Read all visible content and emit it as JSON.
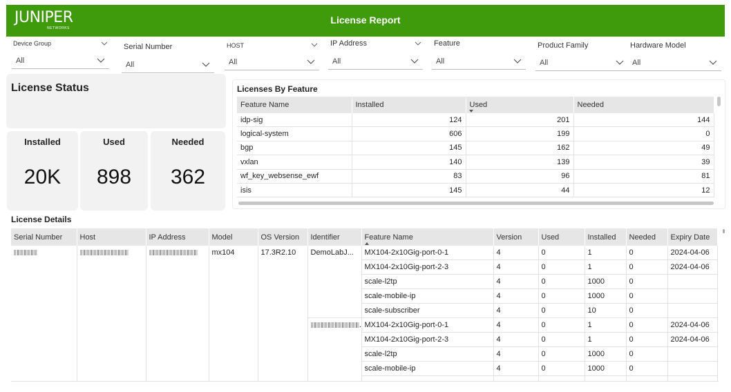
{
  "header": {
    "logo_text": "JUNIPER",
    "logo_sub": "NETWORKS",
    "title": "License Report",
    "background": "#3f9b0b"
  },
  "filters": [
    {
      "label": "Device Group",
      "value": "All"
    },
    {
      "label": "Serial Number",
      "value": "All"
    },
    {
      "label": "HOST",
      "value": "All"
    },
    {
      "label": "IP Address",
      "value": "All"
    },
    {
      "label": "Feature",
      "value": "All"
    },
    {
      "label": "Product Family",
      "value": "All"
    },
    {
      "label": "Hardware Model",
      "value": "All"
    }
  ],
  "license_status": {
    "title": "License Status",
    "installed_label": "Installed",
    "installed_value": "20K",
    "used_label": "Used",
    "used_value": "898",
    "needed_label": "Needed",
    "needed_value": "362"
  },
  "licenses_by_feature": {
    "title": "Licenses By Feature",
    "columns": [
      "Feature Name",
      "Installed",
      "Used",
      "Needed"
    ],
    "sorted_column": "Used",
    "rows": [
      [
        "idp-sig",
        "124",
        "201",
        "144"
      ],
      [
        "logical-system",
        "606",
        "199",
        "0"
      ],
      [
        "bgp",
        "145",
        "162",
        "49"
      ],
      [
        "vxlan",
        "140",
        "139",
        "39"
      ],
      [
        "wf_key_websense_ewf",
        "83",
        "96",
        "81"
      ],
      [
        "isis",
        "145",
        "44",
        "12"
      ]
    ]
  },
  "license_details": {
    "title": "License Details",
    "columns": [
      "Serial Number",
      "Host",
      "IP Address",
      "Model",
      "OS Version",
      "Identifier",
      "Feature Name",
      "Version",
      "Used",
      "Installed",
      "Needed",
      "Expiry Date"
    ],
    "sorted_column": "Feature Name",
    "device": {
      "model": "mx104",
      "os_version": "17.3R2.10",
      "identifier": "DemoLabJ..."
    },
    "rows": [
      {
        "feature": "MX104-2x10Gig-port-0-1",
        "version": "4",
        "used": "0",
        "installed": "1",
        "needed": "0",
        "expiry": "2024-04-06"
      },
      {
        "feature": "MX104-2x10Gig-port-2-3",
        "version": "4",
        "used": "0",
        "installed": "1",
        "needed": "0",
        "expiry": "2024-04-06"
      },
      {
        "feature": "scale-l2tp",
        "version": "4",
        "used": "0",
        "installed": "1000",
        "needed": "0",
        "expiry": ""
      },
      {
        "feature": "scale-mobile-ip",
        "version": "4",
        "used": "0",
        "installed": "1000",
        "needed": "0",
        "expiry": ""
      },
      {
        "feature": "scale-subscriber",
        "version": "4",
        "used": "0",
        "installed": "10",
        "needed": "0",
        "expiry": ""
      },
      {
        "feature": "MX104-2x10Gig-port-0-1",
        "version": "4",
        "used": "0",
        "installed": "1",
        "needed": "0",
        "expiry": "2024-04-06"
      },
      {
        "feature": "MX104-2x10Gig-port-2-3",
        "version": "4",
        "used": "0",
        "installed": "1",
        "needed": "0",
        "expiry": "2024-04-06"
      },
      {
        "feature": "scale-l2tp",
        "version": "4",
        "used": "0",
        "installed": "1000",
        "needed": "0",
        "expiry": ""
      },
      {
        "feature": "scale-mobile-ip",
        "version": "4",
        "used": "0",
        "installed": "1000",
        "needed": "0",
        "expiry": ""
      },
      {
        "feature": "",
        "version": "",
        "used": "",
        "installed": "",
        "needed": "",
        "expiry": ""
      }
    ]
  }
}
